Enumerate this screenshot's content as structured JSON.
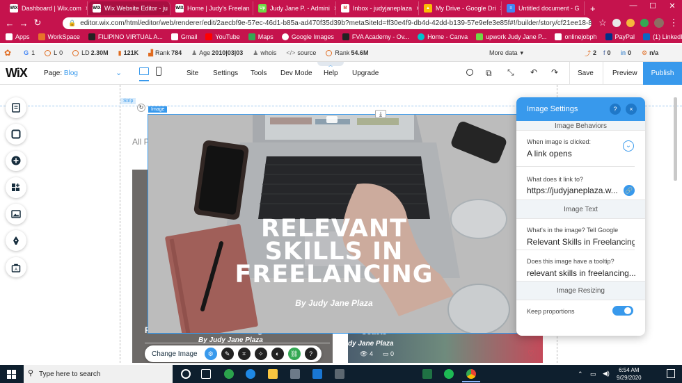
{
  "browser": {
    "tabs": [
      {
        "label": "Dashboard | Wix.com"
      },
      {
        "label": "Wix Website Editor - ju"
      },
      {
        "label": "Home | Judy's Freelan"
      },
      {
        "label": "Judy Jane P. - Admini"
      },
      {
        "label": "Inbox - judyjaneplaza"
      },
      {
        "label": "My Drive - Google Dri"
      },
      {
        "label": "Untitled document - G"
      }
    ],
    "url": "editor.wix.com/html/editor/web/renderer/edit/2aecbf9e-57ec-46d1-b85a-ad470f35d39b?metaSiteId=ff30e4f9-db4d-42dd-b139-57e9efe3e85f#!/builder/story/cf21ee18-89c3-4f8e-968c-209...",
    "bookmarks": [
      "Apps",
      "WorkSpace",
      "FILIPINO VIRTUAL A...",
      "Gmail",
      "YouTube",
      "Maps",
      "Google Images",
      "FVA Academy - Ov...",
      "Home - Canva",
      "upwork Judy Jane P...",
      "onlinejobph",
      "PayPal",
      "(1) LinkedIn"
    ]
  },
  "seo": {
    "items": [
      {
        "label": "G",
        "value": "1"
      },
      {
        "label": "L",
        "value": "0"
      },
      {
        "label": "LD",
        "value": "2.30M"
      },
      {
        "label": "",
        "value": "121K"
      },
      {
        "label": "Rank",
        "value": "784"
      },
      {
        "label": "Age",
        "value": "2010|03|03"
      },
      {
        "label": "",
        "value": "whois"
      },
      {
        "label": "",
        "value": "source"
      },
      {
        "label": "Rank",
        "value": "54.6M"
      }
    ],
    "more": "More data",
    "counts": [
      "2",
      "0",
      "0",
      "n/a"
    ]
  },
  "wix": {
    "logo": "WiX",
    "page_label": "Page:",
    "page_value": "Blog",
    "menu": [
      "Site",
      "Settings",
      "Tools",
      "Dev Mode",
      "Help",
      "Upgrade"
    ],
    "save": "Save",
    "preview": "Preview",
    "publish": "Publish"
  },
  "canvas": {
    "strip_tag": "Strip",
    "image_tag": "Image",
    "filter_text": "All P",
    "card_left_title": "Relevant Skills in Freelancing",
    "card_left_sub": "By Judy Jane Plaza",
    "card_right_title": "Coaets",
    "card_right_sub": "dy Jane Plaza",
    "views": "4",
    "comments": "0"
  },
  "image": {
    "title_line1": "RELEVANT",
    "title_line2": "SKILLS IN",
    "title_line3": "FREELANCING",
    "byline": "By Judy Jane Plaza"
  },
  "panel": {
    "title": "Image Settings",
    "help": "?",
    "close": "×",
    "behaviors_header": "Image Behaviors",
    "click_label": "When image is clicked:",
    "click_value": "A link opens",
    "link_label": "What does it link to?",
    "link_value": "https://judyjaneplaza.w...",
    "text_header": "Image Text",
    "alt_label": "What's in the image? Tell Google",
    "alt_value": "Relevant Skills in Freelancing",
    "tooltip_label": "Does this image have a tooltip?",
    "tooltip_value": "relevant skills in freelancing...",
    "resize_header": "Image Resizing",
    "proportions_label": "Keep proportions"
  },
  "toolbar": {
    "change_image": "Change Image"
  },
  "taskbar": {
    "search_placeholder": "Type here to search",
    "time": "6:54 AM",
    "date": "9/29/2020"
  }
}
